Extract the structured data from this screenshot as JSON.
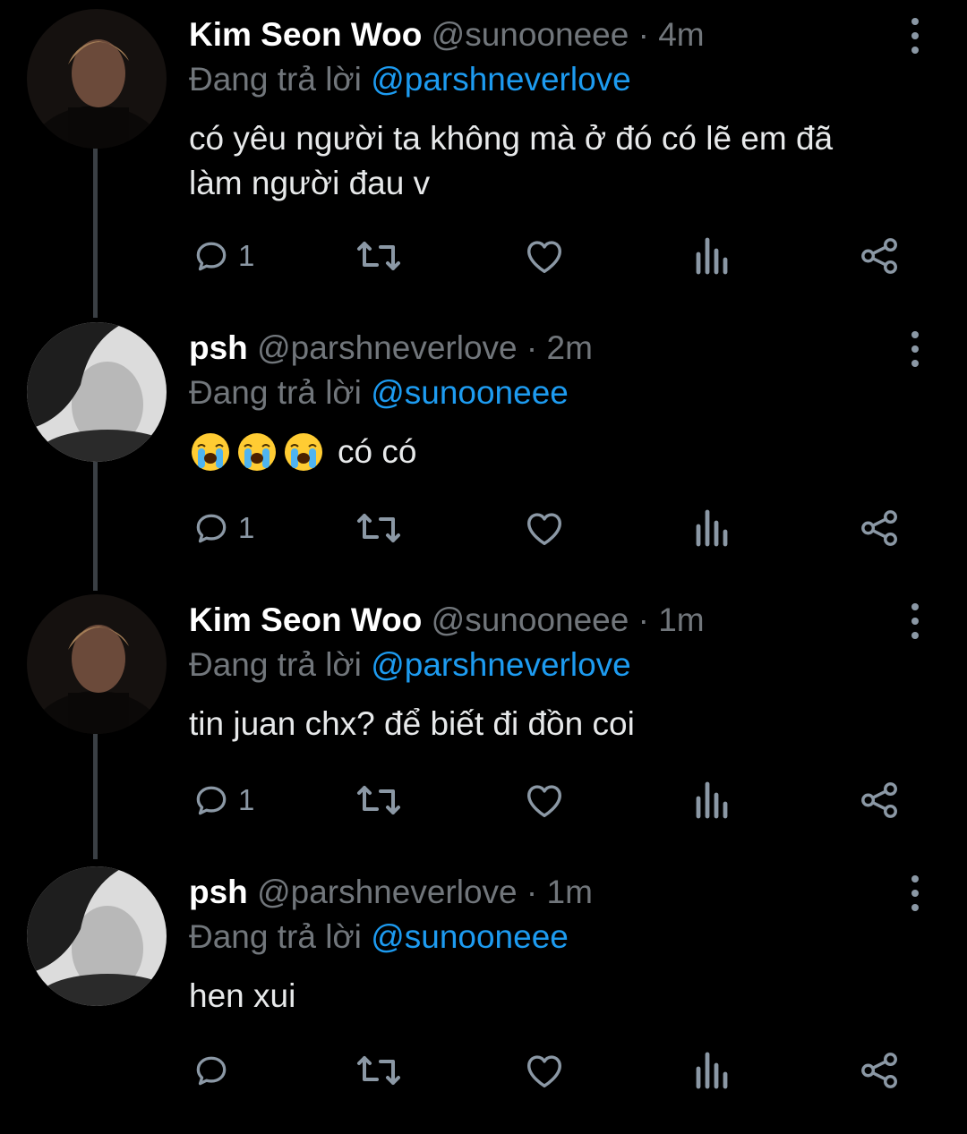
{
  "tweets": [
    {
      "name": "Kim Seon Woo",
      "handle": "@sunooneee",
      "sep": " · ",
      "time": "4m",
      "replying_prefix": "Đang trả lời ",
      "replying_to": "@parshneverlove",
      "text": "có yêu người ta không mà ở đó có lẽ em đã làm người đau v",
      "reply_count": "1"
    },
    {
      "name": "psh",
      "handle": "@parshneverlove",
      "sep": " · ",
      "time": "2m",
      "replying_prefix": "Đang trả lời ",
      "replying_to": "@sunooneee",
      "emoji_icons": [
        "loudly-crying-face",
        "loudly-crying-face",
        "loudly-crying-face"
      ],
      "text": "có có",
      "reply_count": "1"
    },
    {
      "name": "Kim Seon Woo",
      "handle": "@sunooneee",
      "sep": " · ",
      "time": "1m",
      "replying_prefix": "Đang trả lời ",
      "replying_to": "@parshneverlove",
      "text": "tin juan chx? để biết đi đồn coi",
      "reply_count": "1"
    },
    {
      "name": "psh",
      "handle": "@parshneverlove",
      "sep": " · ",
      "time": "1m",
      "replying_prefix": "Đang trả lời ",
      "replying_to": "@sunooneee",
      "text": "hen xui",
      "reply_count": ""
    }
  ],
  "icons": {
    "reply": "reply-icon",
    "retweet": "retweet-icon",
    "like": "heart-icon",
    "views": "analytics-icon",
    "share": "share-icon",
    "more": "more-vertical-icon"
  },
  "colors": {
    "background": "#000000",
    "name": "#ffffff",
    "secondary": "#71767b",
    "mention": "#1d9bf0",
    "icon": "#8b98a5",
    "thread_line": "#3a3f44"
  }
}
